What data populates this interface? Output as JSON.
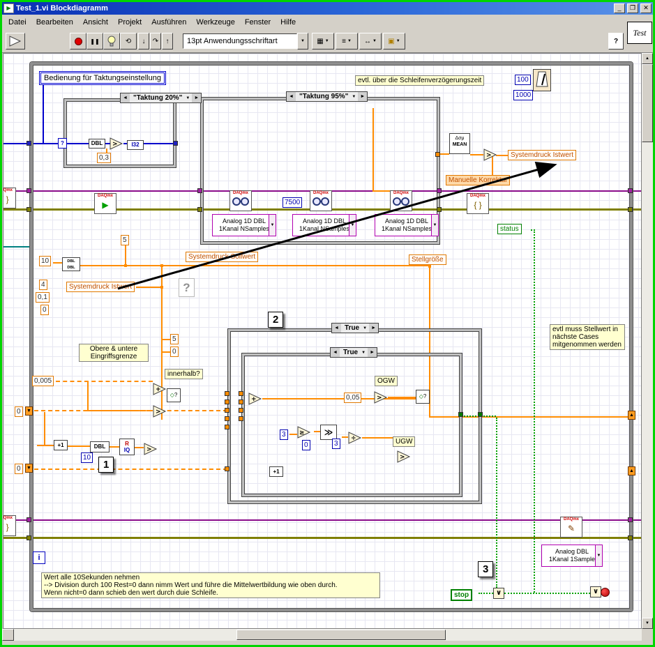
{
  "window": {
    "title": "Test_1.vi Blockdiagramm",
    "controls": {
      "minimize": "_",
      "maximize": "❐",
      "close": "✕"
    }
  },
  "menu": {
    "items": [
      "Datei",
      "Bearbeiten",
      "Ansicht",
      "Projekt",
      "Ausführen",
      "Werkzeuge",
      "Fenster",
      "Hilfe"
    ]
  },
  "toolbar": {
    "font_selector": "13pt Anwendungsschriftart",
    "help": "?",
    "vi_icon": "Test"
  },
  "icons": {
    "left": "◄",
    "right": "►",
    "dropdown": "▼",
    "up": "▲",
    "down": "▼",
    "pause": "❚❚",
    "play": "▶",
    "pencil": "✎",
    "braces": "{ }",
    "plus": "+",
    "gt": ">",
    "ge": "≥",
    "div": "÷",
    "step_into": "↓",
    "step_over": "↷",
    "step_out": "↑",
    "retain": "⟲",
    "align": "▦",
    "distribute": "≡",
    "resize": "↔",
    "reorder": "▣"
  },
  "diagram": {
    "free_labels": {
      "bedienung": "Bedienung für Taktungseinstellung",
      "schleifen_hint": "evtl. über die Schleifenverzögerungszeit",
      "stellwert_hint": "evtl muss Stellwert in nächste Cases mitgenommen werden",
      "eingriffsgrenze_1": "Obere & untere",
      "eingriffsgrenze_2": "Eingriffsgrenze",
      "innerhalb": "innerhalb?",
      "ogw": "OGW",
      "ugw": "UGW",
      "note_line1": "Wert alle 10Sekunden nehmen",
      "note_line2": "--> Division durch 100 Rest=0 dann nimm Wert und führe die Mittelwertbildung wie oben durch.",
      "note_line3": "Wenn nicht=0 dann schieb den wert durch duie Schleife.",
      "seq1": "1",
      "seq2": "2",
      "seq3": "3"
    },
    "case_labels": {
      "taktung20": "\"Taktung 20%\"",
      "taktung95": "\"Taktung 95%\"",
      "true_case": "True"
    },
    "terminals": {
      "systemdruck_istwert": "Systemdruck Istwert",
      "systemdruck_sollwert": "Systemdruck Sollwert",
      "manuelle_korrektur": "Manuelle Korrektur",
      "stellgroesse": "Stellgröße",
      "status": "status",
      "stop": "stop",
      "iteration": "i"
    },
    "constants": {
      "k100": "100",
      "k1000": "1000",
      "k0_3": "0,3",
      "k7500": "7500",
      "k5": "5",
      "k10": "10",
      "k4": "4",
      "k0_1": "0,1",
      "k0": "0",
      "k0_005": "0,005",
      "k0_05": "0,05",
      "k3": "3"
    },
    "nodes": {
      "daqmx": "DAQmx",
      "dbl": "DBL",
      "i32": "I32",
      "mean_sym": "Δσμ",
      "mean": "MEAN",
      "plus1": "+1",
      "quot_r": "R",
      "quot_iq": "IQ",
      "scale": "≫",
      "select_diamond": "◇",
      "question": "?",
      "or": "∨"
    },
    "daq_selectors": {
      "read_line1": "Analog 1D DBL",
      "read_line2": "1Kanal NSamples",
      "write_line1": "Analog DBL",
      "write_line2": "1Kanal 1Sample"
    }
  }
}
